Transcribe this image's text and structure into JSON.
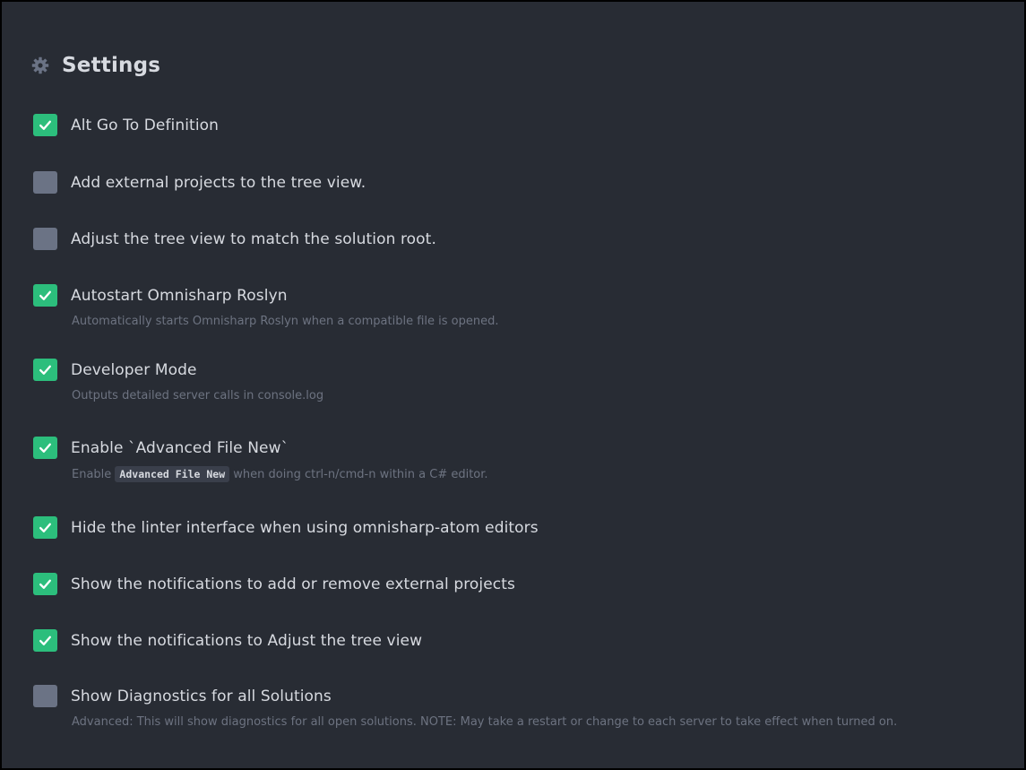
{
  "header": {
    "title": "Settings",
    "icon": "gear-icon"
  },
  "colors": {
    "background": "#282c34",
    "checked": "#2cbe7c",
    "unchecked": "#6b7385",
    "label": "#d7dae0",
    "description": "#6d7381"
  },
  "settings": [
    {
      "label": "Alt Go To Definition",
      "checked": true,
      "description": ""
    },
    {
      "label": "Add external projects to the tree view.",
      "checked": false,
      "description": ""
    },
    {
      "label": "Adjust the tree view to match the solution root.",
      "checked": false,
      "description": ""
    },
    {
      "label": "Autostart Omnisharp Roslyn",
      "checked": true,
      "description": "Automatically starts Omnisharp Roslyn when a compatible file is opened."
    },
    {
      "label": "Developer Mode",
      "checked": true,
      "description": "Outputs detailed server calls in console.log"
    },
    {
      "label": "Enable `Advanced File New`",
      "checked": true,
      "description_pre": "Enable",
      "description_code": "Advanced File New",
      "description_post": "when doing ctrl-n/cmd-n within a C# editor."
    },
    {
      "label": "Hide the linter interface when using omnisharp-atom editors",
      "checked": true,
      "description": ""
    },
    {
      "label": "Show the notifications to add or remove external projects",
      "checked": true,
      "description": ""
    },
    {
      "label": "Show the notifications to Adjust the tree view",
      "checked": true,
      "description": ""
    },
    {
      "label": "Show Diagnostics for all Solutions",
      "checked": false,
      "description": "Advanced: This will show diagnostics for all open solutions. NOTE: May take a restart or change to each server to take effect when turned on."
    }
  ]
}
